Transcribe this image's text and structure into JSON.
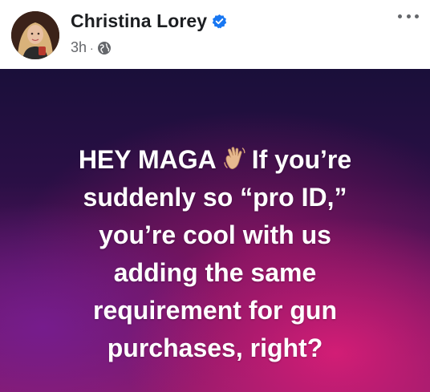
{
  "post": {
    "author": {
      "name": "Christina Lorey",
      "verified": true,
      "verified_icon": "verified-badge-icon",
      "avatar_icon": "avatar"
    },
    "meta": {
      "time": "3h",
      "separator": "·",
      "audience_icon": "globe-icon"
    },
    "menu_icon": "more-options-icon",
    "content": {
      "line1_a": "HEY MAGA",
      "line1_emoji": "waving-hand-icon",
      "line1_b": "If you’re",
      "line2": "suddenly so “pro ID,”",
      "line3": "you’re cool with us",
      "line4": "adding the same",
      "line5": "requirement for gun",
      "line6": "purchases, right?"
    },
    "colors": {
      "text": "#ffffff",
      "verified": "#1877f2",
      "meta": "#65676b",
      "background_top": "#1a0f3a",
      "background_bottom": "#d11a77"
    }
  }
}
